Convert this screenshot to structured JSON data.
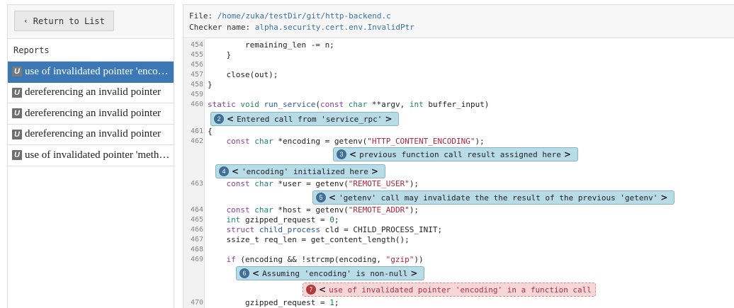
{
  "sidebar": {
    "back_label": "Return to List",
    "reports_heading": "Reports",
    "reports": [
      {
        "icon": "U",
        "label": "use of invalidated pointer 'encod…",
        "active": true
      },
      {
        "icon": "U",
        "label": "dereferencing an invalid pointer",
        "active": false
      },
      {
        "icon": "U",
        "label": "dereferencing an invalid pointer",
        "active": false
      },
      {
        "icon": "U",
        "label": "dereferencing an invalid pointer",
        "active": false
      },
      {
        "icon": "U",
        "label": "use of invalidated pointer 'metho…",
        "active": false
      }
    ]
  },
  "file": {
    "file_label": "File:",
    "path": "/home/zuka/testDir/git/http-backend.c",
    "checker_label": "Checker name:",
    "checker": "alpha.security.cert.env.InvalidPtr"
  },
  "code": {
    "lines": [
      {
        "n": "454",
        "tokens": [
          [
            "tk",
            "        remaining_len -= n;"
          ]
        ]
      },
      {
        "n": "455",
        "tokens": [
          [
            "tk",
            "    }"
          ]
        ]
      },
      {
        "n": "456",
        "tokens": []
      },
      {
        "n": "457",
        "tokens": [
          [
            "tk",
            "    close(out);"
          ]
        ]
      },
      {
        "n": "458",
        "tokens": [
          [
            "tk",
            "}"
          ]
        ]
      },
      {
        "n": "459",
        "tokens": []
      },
      {
        "n": "460",
        "tokens": [
          [
            "kw",
            "static"
          ],
          [
            "tk",
            " "
          ],
          [
            "ty",
            "void"
          ],
          [
            "tk",
            " "
          ],
          [
            "fn",
            "run_service"
          ],
          [
            "tk",
            "("
          ],
          [
            "kw",
            "const"
          ],
          [
            "tk",
            " "
          ],
          [
            "ty",
            "char"
          ],
          [
            "tk",
            " **argv, "
          ],
          [
            "ty",
            "int"
          ],
          [
            "tk",
            " buffer_input)"
          ]
        ]
      },
      {
        "n": "461",
        "tokens": [
          [
            "tk",
            "{"
          ]
        ]
      },
      {
        "n": "462",
        "tokens": [
          [
            "tk",
            "    "
          ],
          [
            "kw",
            "const"
          ],
          [
            "tk",
            " "
          ],
          [
            "ty",
            "char"
          ],
          [
            "tk",
            " *encoding = getenv("
          ],
          [
            "str",
            "\"HTTP_CONTENT_ENCODING\""
          ],
          [
            "tk",
            ");"
          ]
        ]
      },
      {
        "n": "463",
        "tokens": [
          [
            "tk",
            "    "
          ],
          [
            "kw",
            "const"
          ],
          [
            "tk",
            " "
          ],
          [
            "ty",
            "char"
          ],
          [
            "tk",
            " *user = getenv("
          ],
          [
            "str",
            "\"REMOTE_USER\""
          ],
          [
            "tk",
            ");"
          ]
        ]
      },
      {
        "n": "464",
        "tokens": [
          [
            "tk",
            "    "
          ],
          [
            "kw",
            "const"
          ],
          [
            "tk",
            " "
          ],
          [
            "ty",
            "char"
          ],
          [
            "tk",
            " *host = getenv("
          ],
          [
            "str",
            "\"REMOTE_ADDR\""
          ],
          [
            "tk",
            ");"
          ]
        ]
      },
      {
        "n": "465",
        "tokens": [
          [
            "tk",
            "    "
          ],
          [
            "ty",
            "int"
          ],
          [
            "tk",
            " gzipped_request = "
          ],
          [
            "num",
            "0"
          ],
          [
            "tk",
            ";"
          ]
        ]
      },
      {
        "n": "466",
        "tokens": [
          [
            "tk",
            "    "
          ],
          [
            "kw",
            "struct"
          ],
          [
            "tk",
            " "
          ],
          [
            "fn",
            "child_process"
          ],
          [
            "tk",
            " cld = CHILD_PROCESS_INIT;"
          ]
        ]
      },
      {
        "n": "467",
        "tokens": [
          [
            "tk",
            "    ssize_t req_len = get_content_length();"
          ]
        ]
      },
      {
        "n": "468",
        "tokens": []
      },
      {
        "n": "469",
        "tokens": [
          [
            "tk",
            "    "
          ],
          [
            "kw",
            "if"
          ],
          [
            "tk",
            " (encoding && !strcmp(encoding, "
          ],
          [
            "str",
            "\"gzip\""
          ],
          [
            "tk",
            "))"
          ]
        ]
      },
      {
        "n": "470",
        "tokens": [
          [
            "tk",
            "        gzipped_request = "
          ],
          [
            "num",
            "1"
          ],
          [
            "tk",
            ";"
          ]
        ]
      }
    ],
    "steps": [
      {
        "num": "2",
        "text": "Entered call from 'service_rpc'",
        "prev": "<",
        "next": ">",
        "error": false
      },
      {
        "num": "3",
        "text": "previous function call result assigned here",
        "prev": "<",
        "next": ">",
        "error": false
      },
      {
        "num": "4",
        "text": "'encoding' initialized here",
        "prev": "<",
        "next": ">",
        "error": false
      },
      {
        "num": "5",
        "text": "'getenv' call may invalidate the the result of the previous 'getenv'",
        "prev": "<",
        "next": ">",
        "error": false
      },
      {
        "num": "6",
        "text": "Assuming 'encoding' is non-null",
        "prev": "<",
        "next": ">",
        "error": false
      },
      {
        "num": "7",
        "text": "use of invalidated pointer 'encoding' in a function call",
        "prev": "<",
        "next": "",
        "error": true
      }
    ]
  },
  "colors": {
    "active_report": "#3c78b4",
    "step_bubble": "#b8dbe8",
    "error_bubble": "#f7d6d8",
    "path_link": "#3a72a8"
  }
}
